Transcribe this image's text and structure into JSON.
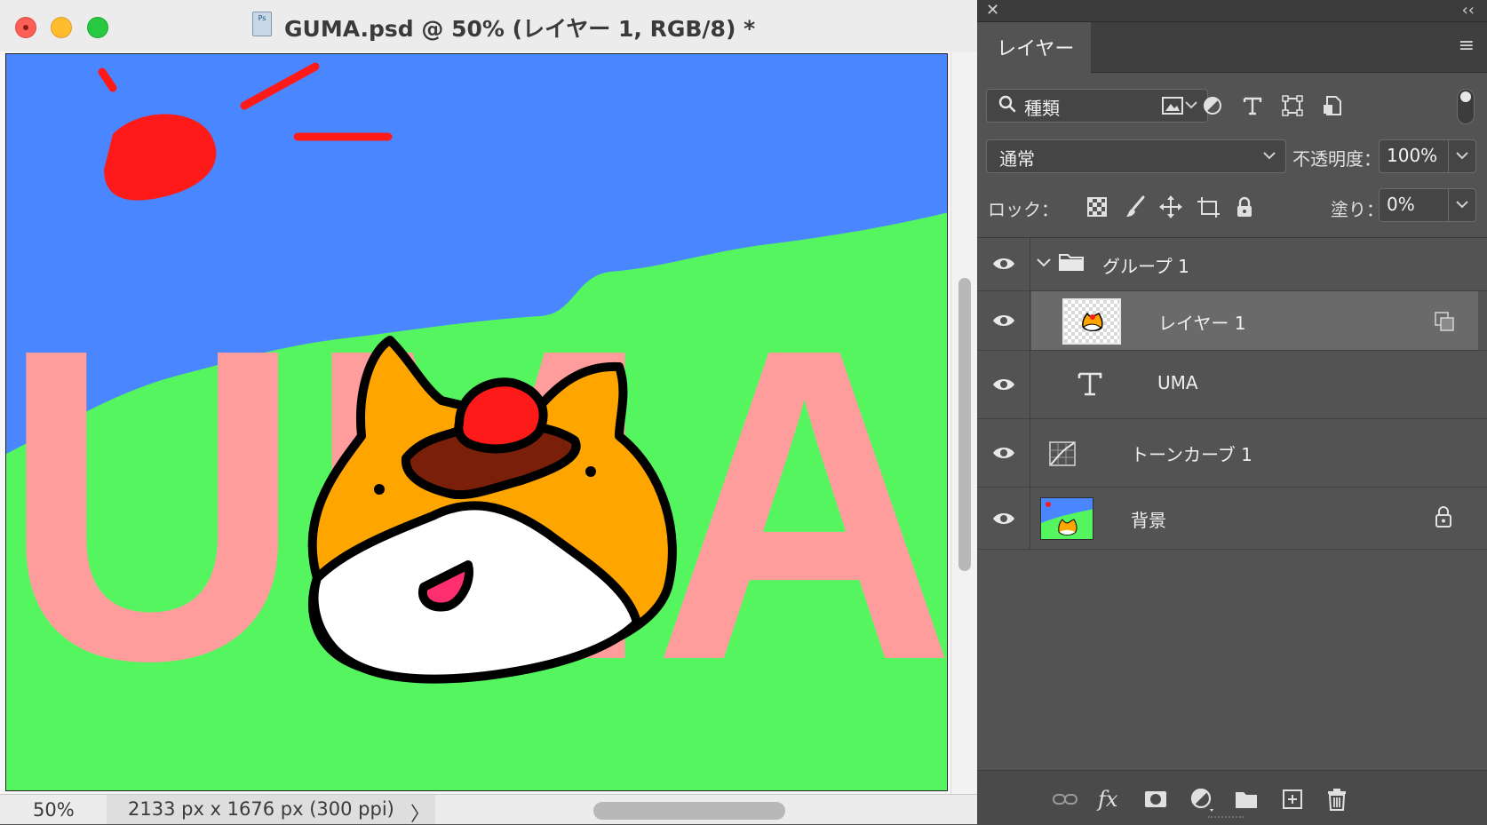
{
  "document": {
    "title": "GUMA.psd @ 50% (レイヤー 1, RGB/8) *",
    "file_badge": "Ps",
    "canvas_text": "UMA",
    "status": {
      "zoom": "50%",
      "doc_info": "2133 px x 1676 px (300 ppi)",
      "arrow": "〉"
    }
  },
  "panel": {
    "close_glyph": "✕",
    "collapse_glyph": "‹‹",
    "tab": "レイヤー",
    "menu_glyph": "≡",
    "filter": {
      "kind_label": "種類",
      "icons": [
        "image-filter-icon",
        "adjustment-filter-icon",
        "type-filter-icon",
        "shape-filter-icon",
        "smart-object-filter-icon"
      ]
    },
    "blend_mode": "通常",
    "opacity_label": "不透明度：",
    "opacity_value": "100%",
    "lock_label": "ロック：",
    "fill_label": "塗り：",
    "fill_value": "0%",
    "layers": [
      {
        "name": "グループ 1",
        "kind": "group",
        "expanded": true,
        "visible": true
      },
      {
        "name": "レイヤー 1",
        "kind": "pixel",
        "selected": true,
        "visible": true
      },
      {
        "name": "UMA",
        "kind": "type",
        "visible": true
      },
      {
        "name": "トーンカーブ 1",
        "kind": "adjustment",
        "visible": true
      },
      {
        "name": "背景",
        "kind": "background",
        "locked": true,
        "visible": true
      }
    ],
    "footer_icons": [
      "link-layers-icon",
      "fx-icon",
      "add-mask-icon",
      "new-adjustment-icon",
      "new-group-icon",
      "new-layer-icon",
      "delete-layer-icon"
    ],
    "fx_label": "fx"
  },
  "colors": {
    "sky": "#4a86ff",
    "grass": "#55f560",
    "text_pink": "#ff9d9d",
    "sun_red": "#ff1a1a",
    "panel_bg": "#535353",
    "selected_row": "#6a6a6a"
  }
}
